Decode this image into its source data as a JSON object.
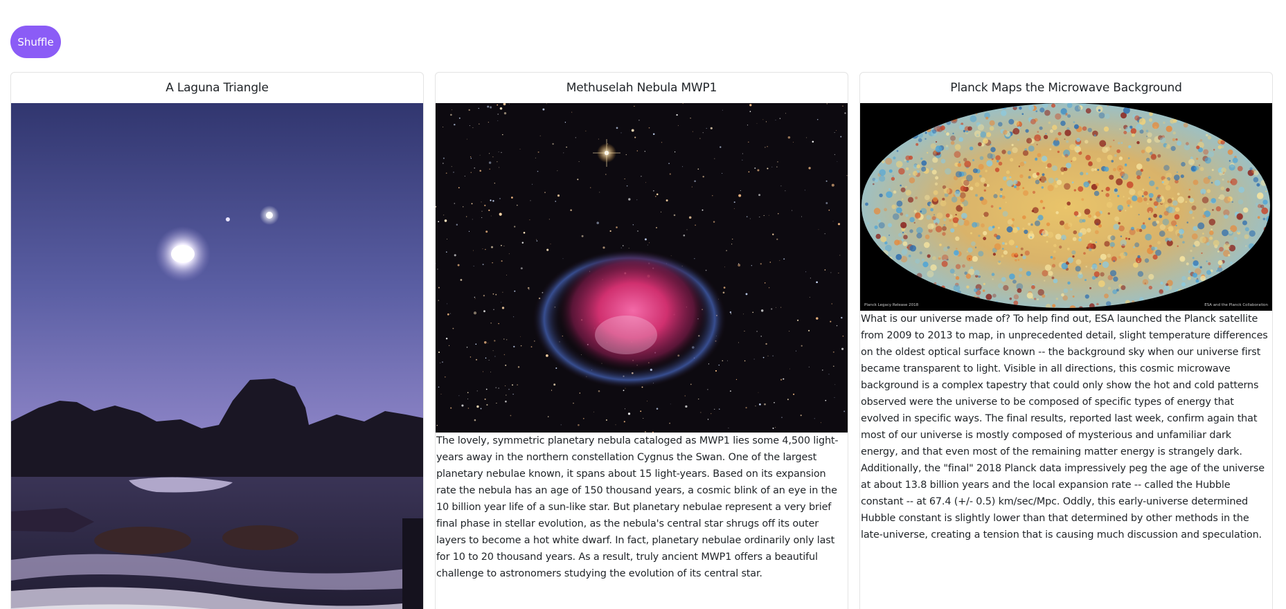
{
  "toolbar": {
    "shuffle_label": "Shuffle"
  },
  "cards": [
    {
      "title": "A Laguna Triangle",
      "image": "moon-venus-over-rocky-shore-photo",
      "description": ""
    },
    {
      "title": "Methuselah Nebula MWP1",
      "image": "planetary-nebula-starfield-photo",
      "description": "The lovely, symmetric planetary nebula cataloged as MWP1 lies some 4,500 light-years away in the northern constellation Cygnus the Swan. One of the largest planetary nebulae known, it spans about 15 light-years. Based on its expansion rate the nebula has an age of 150 thousand years, a cosmic blink of an eye in the 10 billion year life of a sun-like star. But planetary nebulae represent a very brief final phase in stellar evolution, as the nebula's central star shrugs off its outer layers to become a hot white dwarf. In fact, planetary nebulae ordinarily only last for 10 to 20 thousand years. As a result, truly ancient MWP1 offers a beautiful challenge to astronomers studying the evolution of its central star."
    },
    {
      "title": "Planck Maps the Microwave Background",
      "image": "cosmic-microwave-background-map",
      "image_caption_left": "Planck Legacy Release 2018",
      "image_caption_right": "ESA and the Planck Collaboration",
      "description": "What is our universe made of? To help find out, ESA launched the Planck satellite from 2009 to 2013 to map, in unprecedented detail, slight temperature differences on the oldest optical surface known -- the background sky when our universe first became transparent to light. Visible in all directions, this cosmic microwave background is a complex tapestry that could only show the hot and cold patterns observed were the universe to be composed of specific types of energy that evolved in specific ways. The final results, reported last week, confirm again that most of our universe is mostly composed of mysterious and unfamiliar dark energy, and that even most of the remaining matter energy is strangely dark. Additionally, the \"final\" 2018 Planck data impressively peg the age of the universe at about 13.8 billion years and the local expansion rate -- called the Hubble constant -- at 67.4 (+/- 0.5) km/sec/Mpc. Oddly, this early-universe determined Hubble constant is slightly lower than that determined by other methods in the late-universe, creating a tension that is causing much discussion and speculation."
    }
  ]
}
